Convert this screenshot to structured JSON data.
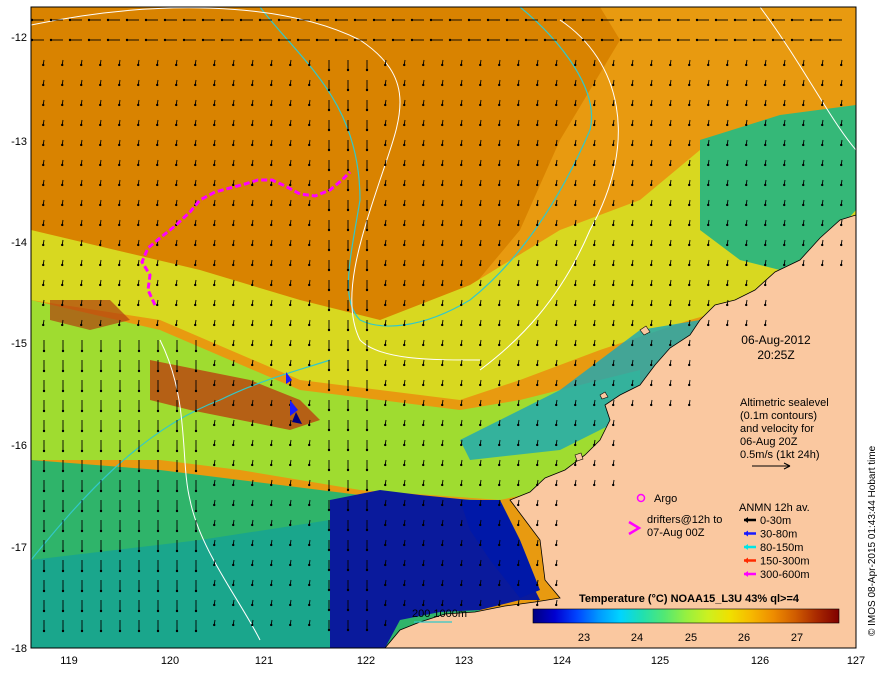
{
  "axes": {
    "x_ticks": [
      "119",
      "120",
      "121",
      "122",
      "123",
      "124",
      "125",
      "126",
      "127"
    ],
    "y_ticks": [
      "-12",
      "-13",
      "-14",
      "-15",
      "-16",
      "-17",
      "-18"
    ]
  },
  "timestamp": {
    "date": "06-Aug-2012",
    "time": "20:25Z"
  },
  "altimetry": {
    "line1": "Altimetric sealevel",
    "line2": "(0.1m contours)",
    "line3": "and velocity for",
    "line4": "06-Aug 20Z",
    "line5": "0.5m/s (1kt 24h)"
  },
  "argo_label": "Argo",
  "drifters": {
    "line1": "drifters@12h to",
    "line2": "07-Aug 00Z"
  },
  "anmn": {
    "title": "ANMN 12h av.",
    "items": [
      {
        "label": "0-30m",
        "color": "#000000"
      },
      {
        "label": "30-80m",
        "color": "#1a1aff"
      },
      {
        "label": "80-150m",
        "color": "#00e5e5"
      },
      {
        "label": "150-300m",
        "color": "#ff2a00"
      },
      {
        "label": "300-600m",
        "color": "#ff00ff"
      }
    ]
  },
  "isobath_label": "200  1000m",
  "colorbar": {
    "title": "Temperature (°C) NOAA15_L3U 43% ql>=4",
    "ticks": [
      "23",
      "24",
      "25",
      "26",
      "27"
    ],
    "colors": [
      "#00007f",
      "#0000d0",
      "#0044ff",
      "#0098ff",
      "#00d4ff",
      "#20e0b0",
      "#52e874",
      "#96f040",
      "#ccf020",
      "#f0e000",
      "#f6b800",
      "#ee8c00",
      "#d05c00",
      "#a82800",
      "#7f0000"
    ]
  },
  "credit": "© IMOS 08-Apr-2015 01:43:44 Hobart time",
  "colors": {
    "land": "#f9c89e",
    "ocean_warm": "#e59100",
    "ocean_cool": "#2db36a",
    "deep": "#00148c"
  }
}
